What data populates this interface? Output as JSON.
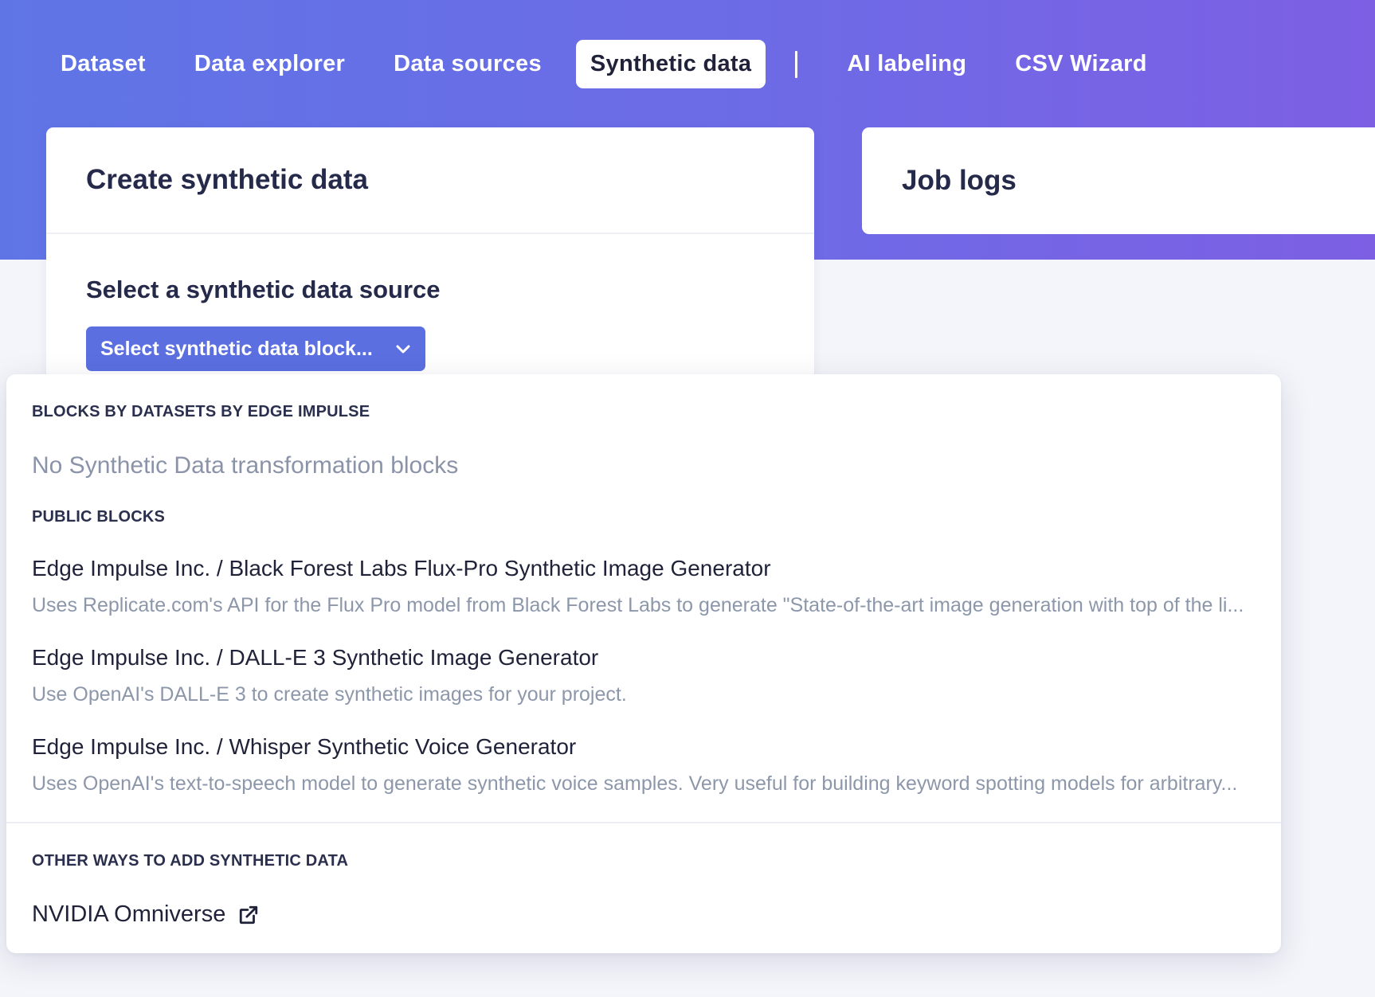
{
  "tabs": [
    {
      "label": "Dataset",
      "active": false
    },
    {
      "label": "Data explorer",
      "active": false
    },
    {
      "label": "Data sources",
      "active": false
    },
    {
      "label": "Synthetic data",
      "active": true
    },
    {
      "label": "AI labeling",
      "active": false
    },
    {
      "label": "CSV Wizard",
      "active": false
    }
  ],
  "create_card": {
    "title": "Create synthetic data",
    "section_title": "Select a synthetic data source",
    "select_label": "Select synthetic data block..."
  },
  "jobs_card": {
    "title": "Job logs"
  },
  "dropdown": {
    "group1_heading": "Blocks by Datasets by Edge Impulse",
    "group1_empty": "No Synthetic Data transformation blocks",
    "group2_heading": "Public blocks",
    "items": [
      {
        "title": "Edge Impulse Inc. / Black Forest Labs Flux-Pro Synthetic Image Generator",
        "description": "Uses Replicate.com's API for the Flux Pro model from Black Forest Labs to generate \"State-of-the-art image generation with top of the li..."
      },
      {
        "title": "Edge Impulse Inc. / DALL-E 3 Synthetic Image Generator",
        "description": "Use OpenAI's DALL-E 3 to create synthetic images for your project."
      },
      {
        "title": "Edge Impulse Inc. / Whisper Synthetic Voice Generator",
        "description": "Uses OpenAI's text-to-speech model to generate synthetic voice samples. Very useful for building keyword spotting models for arbitrary..."
      }
    ],
    "group3_heading": "Other ways to add synthetic data",
    "omniverse_label": "NVIDIA Omniverse"
  },
  "colors": {
    "gradient_start": "#5f75e6",
    "gradient_end": "#7d5fe4",
    "primary_button": "#5b6fe0",
    "muted_text": "#8d97aa"
  },
  "icons": {
    "select_chevron": "chevron-down-icon",
    "omniverse_link": "external-link-icon"
  }
}
